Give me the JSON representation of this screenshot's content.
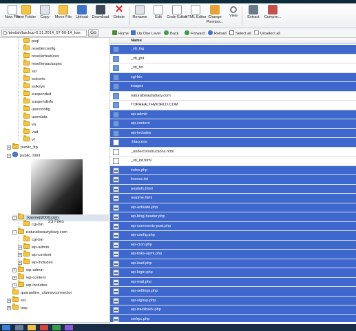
{
  "toolbar": {
    "buttons": [
      {
        "label": "New File",
        "icon": "new-file-icon",
        "color": "#c0c6cc"
      },
      {
        "label": "New Folder",
        "icon": "new-folder-icon",
        "color": "#f2c548"
      },
      {
        "label": "Copy",
        "icon": "copy-icon",
        "color": "#9aa7b5"
      },
      {
        "label": "Move File",
        "icon": "move-file-icon",
        "color": "#f2c548"
      },
      {
        "label": "Upload",
        "icon": "upload-icon",
        "color": "#3f74c9"
      },
      {
        "label": "Download",
        "icon": "download-icon",
        "color": "#3f4d5a"
      },
      {
        "label": "Delete",
        "icon": "delete-icon",
        "color": "#d12a2a"
      },
      {
        "label": "Rename",
        "icon": "rename-icon",
        "color": "#8a98a8"
      },
      {
        "label": "Edit",
        "icon": "edit-icon",
        "color": "#b7c0cc"
      },
      {
        "label": "Code Editor",
        "icon": "code-editor-icon",
        "color": "#a7b1bd"
      },
      {
        "label": "HTML Editor",
        "icon": "html-editor-icon",
        "color": "#a7b1bd"
      },
      {
        "label": "Change Permiss...",
        "icon": "permissions-icon",
        "color": "#e8a23a"
      },
      {
        "label": "View",
        "icon": "view-icon",
        "color": "#6f7c8a"
      },
      {
        "label": "Extract",
        "icon": "extract-icon",
        "color": "#6b7a8a"
      },
      {
        "label": "Compre...",
        "icon": "compress-icon",
        "color": "#c4524a"
      }
    ]
  },
  "pathbar": {
    "path": "/pindah/backup-6.31.2014_07-50-14_kas",
    "go_label": "Go"
  },
  "navbar": {
    "home": "Home",
    "up": "Up One Level",
    "back": "Back",
    "forward": "Forward",
    "reload": "Reload",
    "select_all": "Select all",
    "unselect_all": "Unselect all"
  },
  "tree": {
    "items": [
      {
        "label": "psql"
      },
      {
        "label": "resellerconfig"
      },
      {
        "label": "resellerfeatures"
      },
      {
        "label": "resellerpackages"
      },
      {
        "label": "ssl"
      },
      {
        "label": "sslcerts"
      },
      {
        "label": "sslkeys"
      },
      {
        "label": "suspended"
      },
      {
        "label": "suspendinfo"
      },
      {
        "label": "userconfig"
      },
      {
        "label": "userdata"
      },
      {
        "label": "va"
      },
      {
        "label": "vad"
      },
      {
        "label": "vf"
      },
      {
        "label": "public_ftp"
      },
      {
        "label": "public_html"
      },
      {
        "label": "kasmeji2006.com"
      },
      {
        "label": "cgi-bin"
      },
      {
        "label": "naturalbeautydiary.com"
      },
      {
        "label": "cgi-bin"
      },
      {
        "label": "wp-admin"
      },
      {
        "label": "wp-content"
      },
      {
        "label": "wp-includes"
      },
      {
        "label": "wp-admin"
      },
      {
        "label": "wp-content"
      },
      {
        "label": "wp-includes"
      },
      {
        "label": "quarantine_clamavconnector"
      },
      {
        "label": "ssl"
      },
      {
        "label": "tmp"
      }
    ],
    "files_count": "23 Files"
  },
  "filelist": {
    "header_name": "Name",
    "rows": [
      {
        "name": "_vti_log",
        "kind": "folder",
        "selected": true
      },
      {
        "name": "_vti_pvt",
        "kind": "folder",
        "selected": false
      },
      {
        "name": "_vti_txt",
        "kind": "folder",
        "selected": false
      },
      {
        "name": "cgi-bin",
        "kind": "folder",
        "selected": true
      },
      {
        "name": "images",
        "kind": "folder",
        "selected": true
      },
      {
        "name": "naturalbeautydiary.com",
        "kind": "folder",
        "selected": false
      },
      {
        "name": "TOPHEALTHWORLD.COM",
        "kind": "folder",
        "selected": false
      },
      {
        "name": "wp-admin",
        "kind": "folder",
        "selected": true
      },
      {
        "name": "wp-content",
        "kind": "folder",
        "selected": true
      },
      {
        "name": "wp-includes",
        "kind": "folder",
        "selected": true
      },
      {
        "name": ".htaccess",
        "kind": "file",
        "selected": true
      },
      {
        "name": "_underconstructions.html",
        "kind": "file",
        "selected": false
      },
      {
        "name": "_vti_inf.html",
        "kind": "file",
        "selected": false
      },
      {
        "name": "index.php",
        "kind": "php",
        "selected": true
      },
      {
        "name": "license.txt",
        "kind": "php",
        "selected": true
      },
      {
        "name": "postinfo.html",
        "kind": "php",
        "selected": true
      },
      {
        "name": "readme.html",
        "kind": "php",
        "selected": true
      },
      {
        "name": "wp-activate.php",
        "kind": "php",
        "selected": true
      },
      {
        "name": "wp-blog-header.php",
        "kind": "php",
        "selected": true
      },
      {
        "name": "wp-comments-post.php",
        "kind": "php",
        "selected": true
      },
      {
        "name": "wp-config.php",
        "kind": "php",
        "selected": true
      },
      {
        "name": "wp-cron.php",
        "kind": "php",
        "selected": true
      },
      {
        "name": "wp-links-opml.php",
        "kind": "php",
        "selected": true
      },
      {
        "name": "wp-load.php",
        "kind": "php",
        "selected": true
      },
      {
        "name": "wp-login.php",
        "kind": "php",
        "selected": true
      },
      {
        "name": "wp-mail.php",
        "kind": "php",
        "selected": true
      },
      {
        "name": "wp-settings.php",
        "kind": "php",
        "selected": true
      },
      {
        "name": "wp-signup.php",
        "kind": "php",
        "selected": true
      },
      {
        "name": "wp-trackback.php",
        "kind": "php",
        "selected": true
      },
      {
        "name": "xmlrpc.php",
        "kind": "php",
        "selected": true
      }
    ]
  },
  "colors": {
    "selection": "#3f68cf",
    "folder": "#f2c548",
    "taskbar": "#1a2d47"
  }
}
